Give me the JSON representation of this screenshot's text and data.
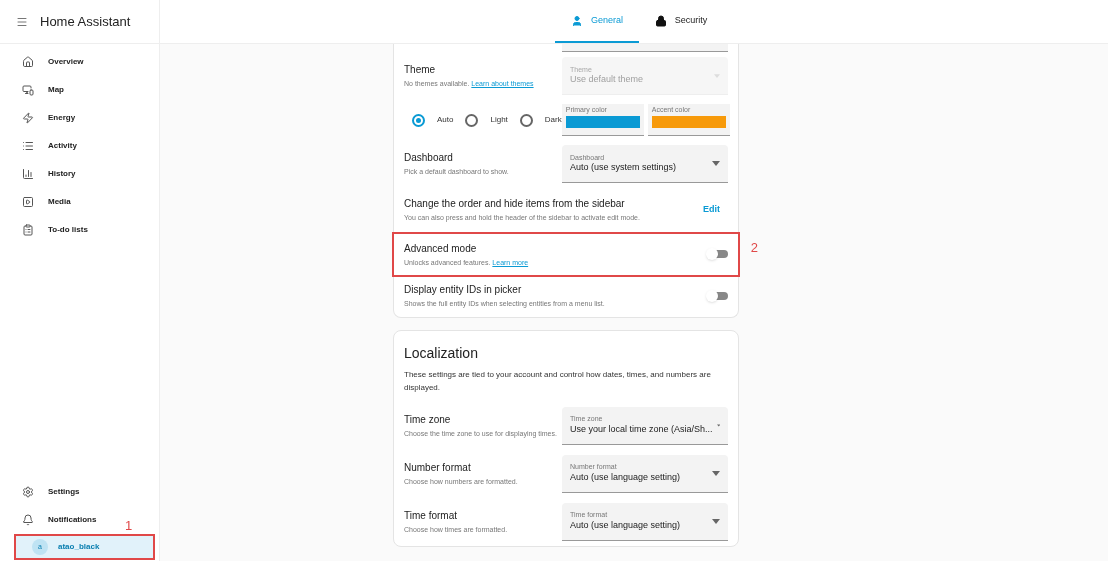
{
  "sidebar": {
    "title": "Home Assistant",
    "items": [
      {
        "label": "Overview",
        "selected": false
      },
      {
        "label": "Map",
        "selected": false
      },
      {
        "label": "Energy",
        "selected": false
      },
      {
        "label": "Activity",
        "selected": false
      },
      {
        "label": "History",
        "selected": false
      },
      {
        "label": "Media",
        "selected": false
      },
      {
        "label": "To-do lists",
        "selected": false
      }
    ],
    "bottom_items": [
      {
        "label": "Settings",
        "selected": false
      },
      {
        "label": "Notifications",
        "selected": false
      }
    ],
    "user": {
      "initial": "a",
      "name": "atao_black",
      "selected": true
    }
  },
  "tabs": [
    {
      "label": "General",
      "selected": true
    },
    {
      "label": "Security",
      "selected": false
    }
  ],
  "general_card": {
    "rows": [
      {
        "kind": "theme",
        "title": "Theme",
        "description": "No themes available.",
        "link": "Learn about themes",
        "select": {
          "label": "Theme",
          "value": "Use default theme",
          "disabled": true
        }
      },
      {
        "kind": "mode",
        "options": [
          {
            "label": "Auto",
            "selected": true
          },
          {
            "label": "Light",
            "selected": false
          },
          {
            "label": "Dark",
            "selected": false
          }
        ],
        "colors": [
          {
            "label": "Primary color",
            "color": "#0a9ad4"
          },
          {
            "label": "Accent color",
            "color": "#f79a0a"
          }
        ]
      },
      {
        "kind": "select",
        "title": "Dashboard",
        "description": "Pick a default dashboard to show.",
        "select": {
          "label": "Dashboard",
          "value": "Auto (use system settings)",
          "disabled": false
        }
      },
      {
        "kind": "action",
        "title": "Change the order and hide items from the sidebar",
        "description": "You can also press and hold the header of the sidebar to activate edit mode.",
        "button": "Edit"
      },
      {
        "kind": "toggle",
        "title": "Advanced mode",
        "description": "Unlocks advanced features.",
        "link": "Learn more",
        "on": false,
        "annotation": "2"
      },
      {
        "kind": "toggle",
        "title": "Display entity IDs in picker",
        "description": "Shows the full entity IDs when selecting entities from a menu list.",
        "on": false
      }
    ]
  },
  "localization_card": {
    "title": "Localization",
    "description": "These settings are tied to your account and control how dates, times, and numbers are displayed.",
    "rows": [
      {
        "kind": "select",
        "title": "Time zone",
        "description": "Choose the time zone to use for displaying times.",
        "select": {
          "label": "Time zone",
          "value": "Use your local time zone (Asia/Sh...",
          "disabled": false
        }
      },
      {
        "kind": "select",
        "title": "Number format",
        "description": "Choose how numbers are formatted.",
        "select": {
          "label": "Number format",
          "value": "Auto (use language setting)",
          "disabled": false
        }
      },
      {
        "kind": "select",
        "title": "Time format",
        "description": "Choose how times are formatted.",
        "select": {
          "label": "Time format",
          "value": "Auto (use language setting)",
          "disabled": false
        }
      }
    ]
  },
  "user_annotation": "1"
}
